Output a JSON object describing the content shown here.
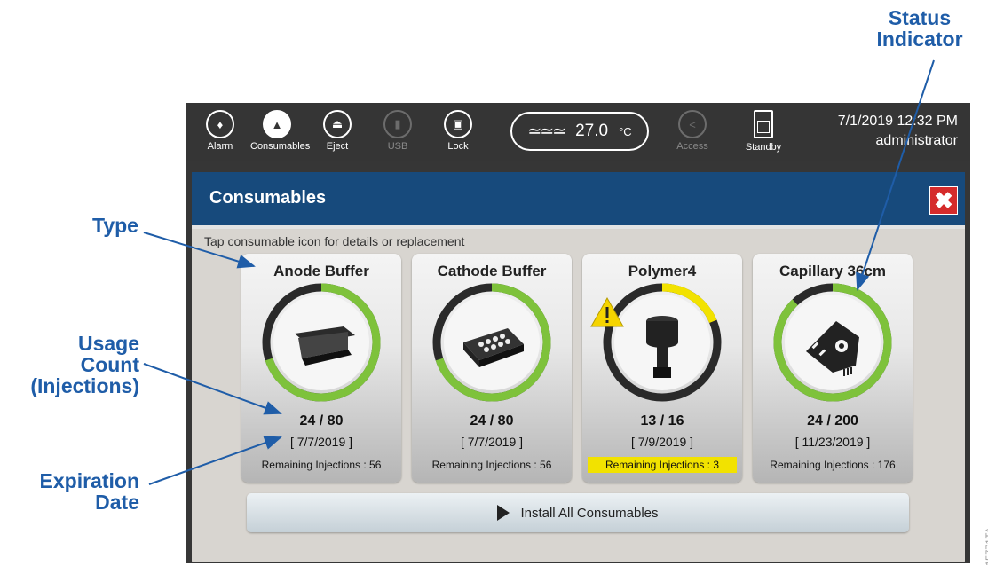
{
  "callouts": {
    "status": "Status Indicator",
    "type": "Type",
    "usage": "Usage Count (Injections)",
    "expiration": "Expiration Date",
    "figure_id": "15771TA"
  },
  "topbar": {
    "buttons": [
      {
        "label": "Alarm",
        "icon": "bell-icon",
        "enabled": true
      },
      {
        "label": "Consumables",
        "icon": "consumables-icon",
        "enabled": true,
        "active": true
      },
      {
        "label": "Eject",
        "icon": "eject-icon",
        "enabled": true
      },
      {
        "label": "USB",
        "icon": "usb-icon",
        "enabled": false
      },
      {
        "label": "Lock",
        "icon": "lock-icon",
        "enabled": true
      }
    ],
    "temperature": {
      "value": "27.0",
      "unit": "°C"
    },
    "access_label": "Access",
    "standby_label": "Standby",
    "datetime": "7/1/2019 12:32 PM",
    "user": "administrator"
  },
  "dialog": {
    "title": "Consumables",
    "hint": "Tap consumable icon for details or replacement",
    "install_label": "Install All Consumables",
    "cards": [
      {
        "name": "Anode Buffer",
        "count": "24 / 80",
        "date": "[ 7/7/2019 ]",
        "remaining": "Remaining Injections : 56",
        "status_color": "#7ec23b",
        "used": 24,
        "total": 80,
        "warning": false
      },
      {
        "name": "Cathode Buffer",
        "count": "24 / 80",
        "date": "[ 7/7/2019 ]",
        "remaining": "Remaining Injections : 56",
        "status_color": "#7ec23b",
        "used": 24,
        "total": 80,
        "warning": false
      },
      {
        "name": "Polymer4",
        "count": "13 / 16",
        "date": "[ 7/9/2019 ]",
        "remaining": "Remaining Injections : 3",
        "status_color": "#f2e200",
        "used": 13,
        "total": 16,
        "warning": true
      },
      {
        "name": "Capillary 36cm",
        "count": "24 / 200",
        "date": "[ 11/23/2019 ]",
        "remaining": "Remaining Injections : 176",
        "status_color": "#7ec23b",
        "used": 24,
        "total": 200,
        "warning": false
      }
    ]
  }
}
